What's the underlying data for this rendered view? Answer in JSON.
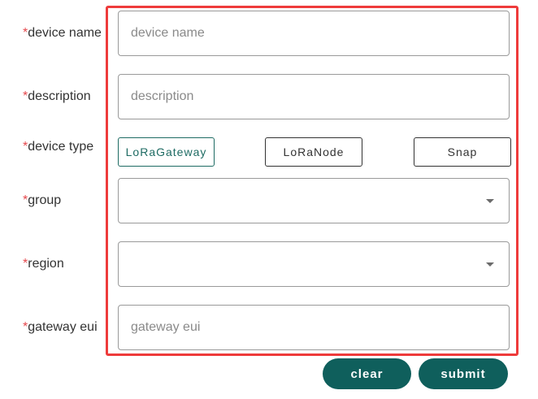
{
  "form": {
    "required_mark": "*",
    "fields": {
      "device_name": {
        "label": "device name",
        "placeholder": "device name",
        "value": ""
      },
      "description": {
        "label": "description",
        "placeholder": "description",
        "value": ""
      },
      "device_type": {
        "label": "device type",
        "options": [
          "LoRaGateway",
          "LoRaNode",
          "Snap"
        ],
        "selected": "LoRaGateway"
      },
      "group": {
        "label": "group",
        "value": ""
      },
      "region": {
        "label": "region",
        "value": ""
      },
      "gateway_eui": {
        "label": "gateway eui",
        "placeholder": "gateway eui",
        "value": ""
      }
    }
  },
  "actions": {
    "clear_label": "clear",
    "submit_label": "submit"
  },
  "colors": {
    "accent": "#0f5f5c",
    "required": "#e5484d",
    "highlight": "#ee3b3b",
    "selected_option": "#1e6b63"
  }
}
